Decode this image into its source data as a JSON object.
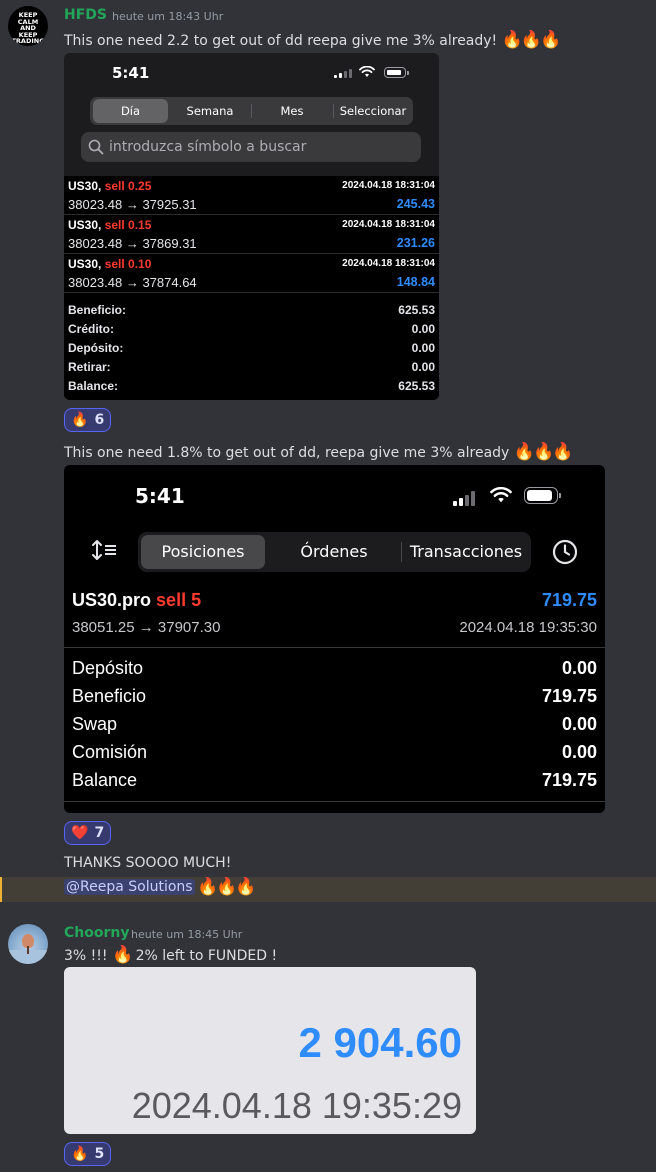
{
  "messages": [
    {
      "author": "HFDS",
      "avatar_lines": [
        "KEEP",
        "CALM",
        "AND",
        "KEEP",
        "TRADING"
      ],
      "time": "heute um 18:43 Uhr",
      "text1": "This one need 2.2 to get out of dd reepa give me 3% already!",
      "text1_emoji": "🔥🔥🔥",
      "reaction1": {
        "emoji": "🔥",
        "count": "6"
      },
      "text2": "This one need 1.8% to get out of dd, reepa give me 3% already",
      "text2_emoji": "🔥🔥🔥",
      "reaction2": {
        "emoji": "❤️",
        "count": "7"
      },
      "text3": "THANKS SOOOO MUCH!",
      "mention": "@Reepa Solutions",
      "mention_emoji": "🔥🔥🔥"
    },
    {
      "author": "Choorny",
      "time": "heute um 18:45 Uhr",
      "text_a": "3% !!!",
      "text_emoji": "🔥",
      "text_b": "2% left to FUNDED !",
      "reaction": {
        "emoji": "🔥",
        "count": "5"
      }
    }
  ],
  "screenshot1": {
    "status_time": "5:41",
    "tabs": [
      "Día",
      "Semana",
      "Mes",
      "Seleccionar"
    ],
    "active_tab": "Día",
    "search_placeholder": "introduzca símbolo a buscar",
    "trades": [
      {
        "symbol": "US30,",
        "side": "sell 0.25",
        "datetime": "2024.04.18 18:31:04",
        "prices": "38023.48 → 37925.31",
        "profit": "245.43"
      },
      {
        "symbol": "US30,",
        "side": "sell 0.15",
        "datetime": "2024.04.18 18:31:04",
        "prices": "38023.48 → 37869.31",
        "profit": "231.26"
      },
      {
        "symbol": "US30,",
        "side": "sell 0.10",
        "datetime": "2024.04.18 18:31:04",
        "prices": "38023.48 → 37874.64",
        "profit": "148.84"
      }
    ],
    "summary": [
      {
        "label": "Beneficio:",
        "value": "625.53"
      },
      {
        "label": "Crédito:",
        "value": "0.00"
      },
      {
        "label": "Depósito:",
        "value": "0.00"
      },
      {
        "label": "Retirar:",
        "value": "0.00"
      },
      {
        "label": "Balance:",
        "value": "625.53"
      }
    ]
  },
  "screenshot2": {
    "status_time": "5:41",
    "tabs": [
      "Posiciones",
      "Órdenes",
      "Transacciones"
    ],
    "active_tab": "Posiciones",
    "position": {
      "symbol": "US30.pro",
      "side": "sell 5",
      "profit": "719.75",
      "prices": "38051.25 → 37907.30",
      "datetime": "2024.04.18 19:35:30"
    },
    "summary": [
      {
        "label": "Depósito",
        "value": "0.00"
      },
      {
        "label": "Beneficio",
        "value": "719.75"
      },
      {
        "label": "Swap",
        "value": "0.00"
      },
      {
        "label": "Comisión",
        "value": "0.00"
      },
      {
        "label": "Balance",
        "value": "719.75"
      }
    ]
  },
  "screenshot3": {
    "amount": "2 904.60",
    "datetime": "2024.04.18 19:35:29"
  }
}
